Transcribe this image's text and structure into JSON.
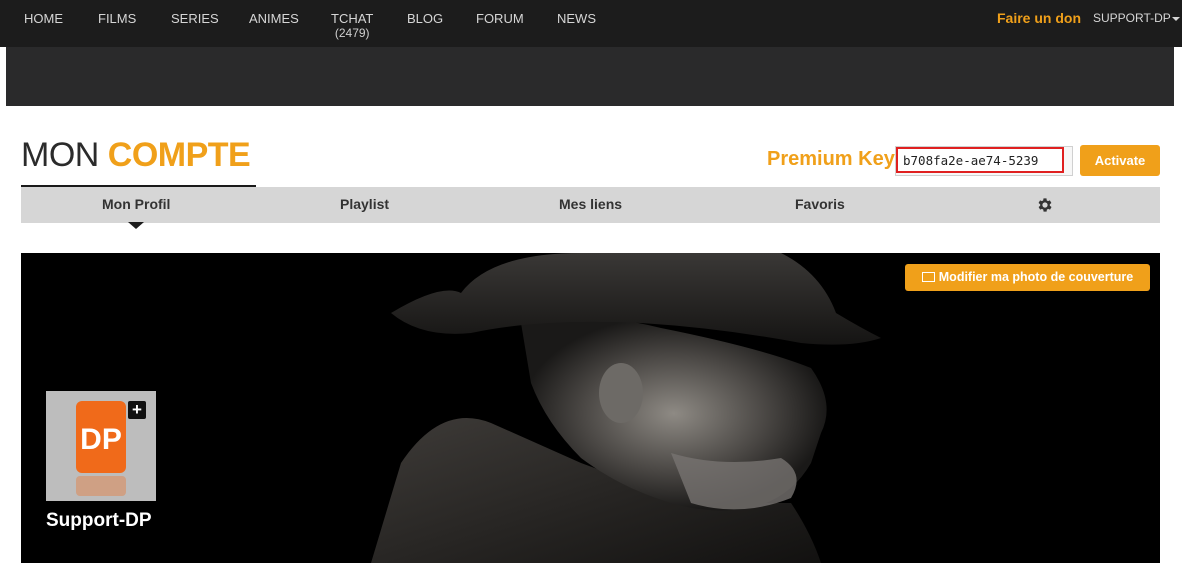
{
  "nav": {
    "items": [
      {
        "label": "HOME"
      },
      {
        "label": "FILMS"
      },
      {
        "label": "SERIES"
      },
      {
        "label": "ANIMES"
      },
      {
        "label": "TCHAT",
        "sub": "(2479)"
      },
      {
        "label": "BLOG"
      },
      {
        "label": "FORUM"
      },
      {
        "label": "NEWS"
      }
    ],
    "donate": "Faire un don",
    "user": "SUPPORT-DP"
  },
  "page": {
    "title_light": "MON",
    "title_bold": "COMPTE"
  },
  "premium": {
    "label": "Premium Key",
    "value": "b708fa2e-ae74-5239",
    "activate": "Activate"
  },
  "tabs": [
    {
      "label": "Mon Profil",
      "active": true
    },
    {
      "label": "Playlist"
    },
    {
      "label": "Mes liens"
    },
    {
      "label": "Favoris"
    }
  ],
  "tabs_settings_icon": "gear-icon",
  "cover": {
    "button": "Modifier ma photo de couverture",
    "avatar_text": "DP",
    "username": "Support-DP"
  },
  "colors": {
    "accent": "#f0a01a",
    "nav_bg": "#1c1c1c",
    "tab_bg": "#d6d6d6"
  }
}
